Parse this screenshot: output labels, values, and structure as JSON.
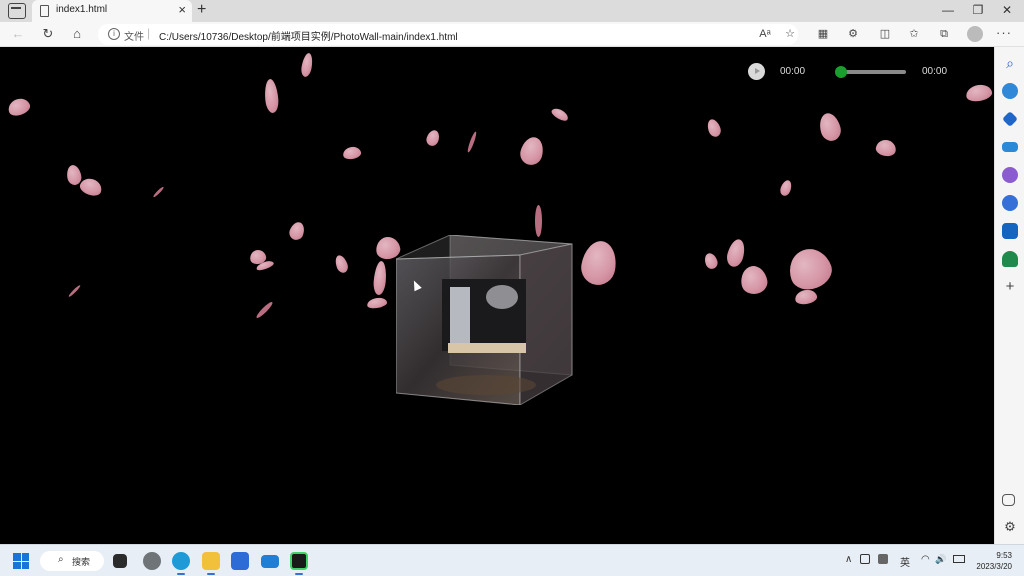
{
  "browser": {
    "tab": {
      "title": "index1.html",
      "close_glyph": "×"
    },
    "new_tab_glyph": "+",
    "window_controls": {
      "minimize": "—",
      "restore": "❐",
      "close": "✕"
    },
    "address": {
      "scheme_label": "文件",
      "separator": "|",
      "url": "C:/Users/10736/Desktop/前端项目实例/PhotoWall-main/index1.html"
    },
    "nav": {
      "back": "←",
      "refresh": "↻",
      "home": "⌂"
    },
    "toolbar_icons": [
      "read-aloud-icon",
      "favorite-star-icon",
      "apps-icon",
      "extensions-icon",
      "split-screen-icon",
      "favorites-icon",
      "collections-icon",
      "profile-icon",
      "more-icon"
    ],
    "toolbar_glyphs": {
      "read_aloud": "Aᵃ",
      "favorite": "☆",
      "apps": "▦",
      "extensions": "⚙",
      "split": "◫",
      "favorites": "✩",
      "collections": "⧉",
      "more": "···"
    }
  },
  "player": {
    "current_time": "00:00",
    "total_time": "00:00",
    "progress": 0,
    "accent_color": "#1a9e2d"
  },
  "sidebar": {
    "icons": [
      "search-icon",
      "bing-chat-icon",
      "shopping-tag-icon",
      "tools-briefcase-icon",
      "games-icon",
      "office-icon",
      "outlook-icon",
      "tree-icon",
      "add-icon",
      "sidebar-toggle-icon",
      "settings-icon"
    ],
    "glyphs": {
      "search": "⌕",
      "add": "+",
      "settings": "⚙"
    }
  },
  "taskbar": {
    "search_label": "搜索",
    "search_glyph": "⌕",
    "apps": [
      "windows-start-icon",
      "task-view-icon",
      "chrome-icon",
      "edge-icon",
      "file-explorer-icon",
      "store-icon",
      "mail-icon",
      "pycharm-icon"
    ],
    "tray": {
      "chevron": "∧",
      "ime": "英",
      "wifi": "◠",
      "volume": "🔊"
    },
    "time": "9:53",
    "date": "2023/3/20"
  }
}
